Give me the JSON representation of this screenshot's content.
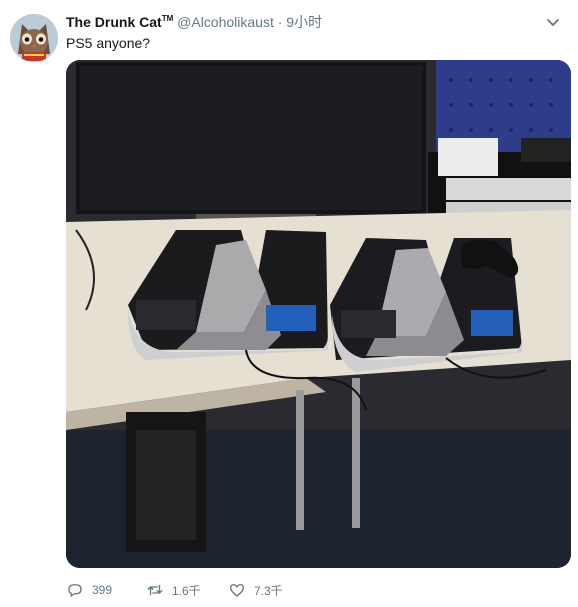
{
  "tweet": {
    "author": {
      "display_name": "The Drunk Cat",
      "trademark": "TM",
      "handle": "@Alcoholikaust",
      "avatar": "cat-avatar"
    },
    "separator": "·",
    "timestamp": "9小时",
    "text": "PS5 anyone?",
    "media": {
      "kind": "photo",
      "description_icon": "photo-two-devkits"
    },
    "actions": {
      "reply_count": "399",
      "retweet_count": "1.6千",
      "like_count": "7.3千"
    },
    "icons": {
      "reply": "reply-icon",
      "retweet": "retweet-icon",
      "like": "heart-icon",
      "menu": "chevron-down-icon"
    },
    "colors": {
      "text": "#14171a",
      "secondary": "#657786"
    }
  }
}
